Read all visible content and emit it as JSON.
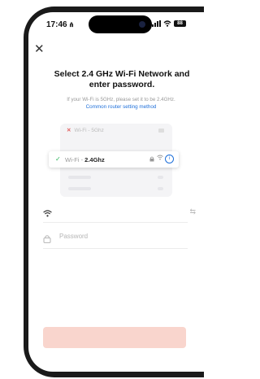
{
  "status_bar": {
    "time": "17:46",
    "time_glyph": "⋔",
    "battery_level": "88"
  },
  "header": {
    "close_icon": "close-icon",
    "title": "Select 2.4 GHz Wi-Fi Network and enter password.",
    "hint": "If your Wi-Fi is 5GHz, please set it to be 2.4GHz.",
    "hint_link": "Common router setting method"
  },
  "illustration": {
    "bad_network_prefix": "Wi-Fi - ",
    "bad_network_band": "5Ghz",
    "good_network_prefix": "Wi-Fi - ",
    "good_network_band": "2.4Ghz",
    "info_glyph": "i"
  },
  "form": {
    "ssid_value": "",
    "password_placeholder": "Password",
    "password_value": ""
  },
  "footer": {
    "next_label": ""
  },
  "colors": {
    "accent": "#1e6fd9",
    "success": "#2db45b",
    "error": "#e25c5c",
    "button_disabled": "#f9d5cd"
  }
}
